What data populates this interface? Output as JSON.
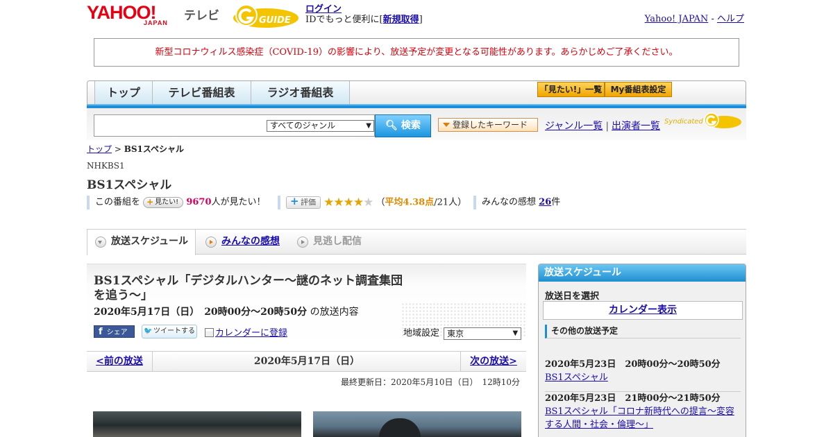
{
  "header": {
    "yahoo_logo": "YAHOO!",
    "japan_logo": "JAPAN",
    "tv_label": "テレビ",
    "gguide_logo": "G GUIDE",
    "login": "ログイン",
    "login_sub_prefix": "IDでもっと便利に[",
    "signup": "新規取得",
    "login_sub_suffix": "]",
    "yahoo_japan_link": "Yahoo! JAPAN",
    "separator": "-",
    "help_link": "ヘルプ"
  },
  "notice": "新型コロナウィルス感染症（COVID-19）の影響により、放送予定が変更となる可能性があります。あらかじめご了承ください。",
  "nav": {
    "tabs": [
      "トップ",
      "テレビ番組表",
      "ラジオ番組表"
    ],
    "mitai_list": "「見たい!」一覧",
    "my_schedule": "My番組表設定"
  },
  "search": {
    "genre_selected": "すべてのジャンル",
    "button": "検索",
    "keyword_button": "登録したキーワード",
    "genre_list_link": "ジャンル一覧",
    "link_sep": "|",
    "performer_list_link": "出演者一覧",
    "syndicated": "Syndicated"
  },
  "breadcrumb": {
    "top": "トップ",
    "sep": " > ",
    "current": "BS1スペシャル"
  },
  "program": {
    "station": "NHKBS1",
    "title": "BS1スペシャル",
    "mitai_prefix": "この番組を",
    "mitai_button": "見たい!",
    "mitai_count": "9670",
    "mitai_suffix": "人が見たい！",
    "rate_button": "評価",
    "rating_stars": 4.38,
    "rating_open": "（",
    "rating_avg": "平均4.38点",
    "rating_count": "/21人）",
    "impressions_prefix": "みんなの感想",
    "impressions_count": "26",
    "impressions_suffix": "件"
  },
  "tabs": {
    "schedule": "放送スケジュール",
    "impressions": "みんなの感想",
    "streaming": "見逃し配信"
  },
  "episode": {
    "title": "BS1スペシャル「デジタルハンター～謎のネット調査集団を追う～」",
    "datetime": "2020年5月17日（日）　20時00分～20時50分",
    "datetime_suffix": "の放送内容",
    "fb_share": "シェア",
    "tweet": "ツイートする",
    "calendar_register": "カレンダーに登録",
    "region_label": "地域設定",
    "region_value": "東京"
  },
  "pager": {
    "prev": "<前の放送",
    "current": "2020年5月17日（日）",
    "next": "次の放送>"
  },
  "updated": "最終更新日：2020年5月10日（日）　12時10分",
  "sidebar": {
    "title": "放送スケジュール",
    "date_label": "放送日を選択",
    "calendar_button": "カレンダー表示",
    "other_title": "その他の放送予定",
    "items": [
      {
        "datetime": "2020年5月23日　20時00分～20時50分",
        "title": "BS1スペシャル"
      },
      {
        "datetime": "2020年5月23日　21時00分～21時50分",
        "title": "BS1スペシャル「コロナ新時代への提言～変容する人間・社会・倫理～」"
      }
    ]
  }
}
